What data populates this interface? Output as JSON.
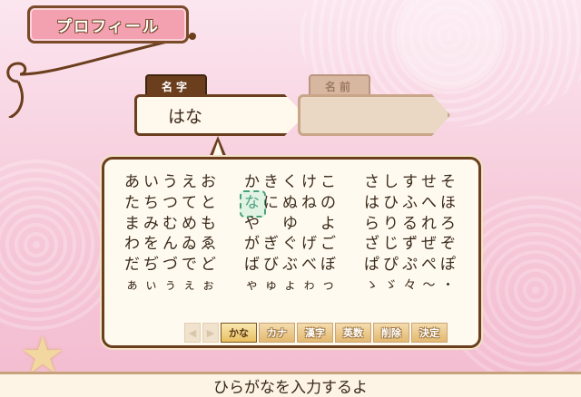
{
  "title": "プロフィール",
  "name_fields": {
    "family_label": "名字",
    "family_value": "はな",
    "given_label": "名前",
    "given_value": ""
  },
  "keyboard": {
    "groups": [
      [
        [
          "あ",
          "い",
          "う",
          "え",
          "お"
        ],
        [
          "た",
          "ち",
          "つ",
          "て",
          "と"
        ],
        [
          "ま",
          "み",
          "む",
          "め",
          "も"
        ],
        [
          "わ",
          "を",
          "ん",
          "ゐ",
          "ゑ"
        ],
        [
          "だ",
          "ぢ",
          "づ",
          "で",
          "ど"
        ],
        [
          "ぁ",
          "ぃ",
          "ぅ",
          "ぇ",
          "ぉ"
        ]
      ],
      [
        [
          "か",
          "き",
          "く",
          "け",
          "こ"
        ],
        [
          "な",
          "に",
          "ぬ",
          "ね",
          "の"
        ],
        [
          "や",
          "",
          "ゆ",
          "",
          "よ"
        ],
        [
          "が",
          "ぎ",
          "ぐ",
          "げ",
          "ご"
        ],
        [
          "ば",
          "び",
          "ぶ",
          "べ",
          "ぼ"
        ],
        [
          "ゃ",
          "ゅ",
          "ょ",
          "ゎ",
          "っ"
        ]
      ],
      [
        [
          "さ",
          "し",
          "す",
          "せ",
          "そ"
        ],
        [
          "は",
          "ひ",
          "ふ",
          "へ",
          "ほ"
        ],
        [
          "ら",
          "り",
          "る",
          "れ",
          "ろ"
        ],
        [
          "ざ",
          "じ",
          "ず",
          "ぜ",
          "ぞ"
        ],
        [
          "ぱ",
          "ぴ",
          "ぷ",
          "ぺ",
          "ぽ"
        ],
        [
          "ゝ",
          "ゞ",
          "々",
          "～",
          "・"
        ]
      ]
    ],
    "selected_key": "な"
  },
  "modes": {
    "left_arrow": "◀",
    "right_arrow": "▶",
    "kana": "かな",
    "katakana": "カナ",
    "kanji": "漢字",
    "alnum": "英数",
    "delete": "削除",
    "confirm": "決定"
  },
  "hint": "ひらがなを入力するよ",
  "colors": {
    "frame": "#6b3f1d",
    "title_bg": "#f3a0b0",
    "selection": "#49a07a"
  }
}
